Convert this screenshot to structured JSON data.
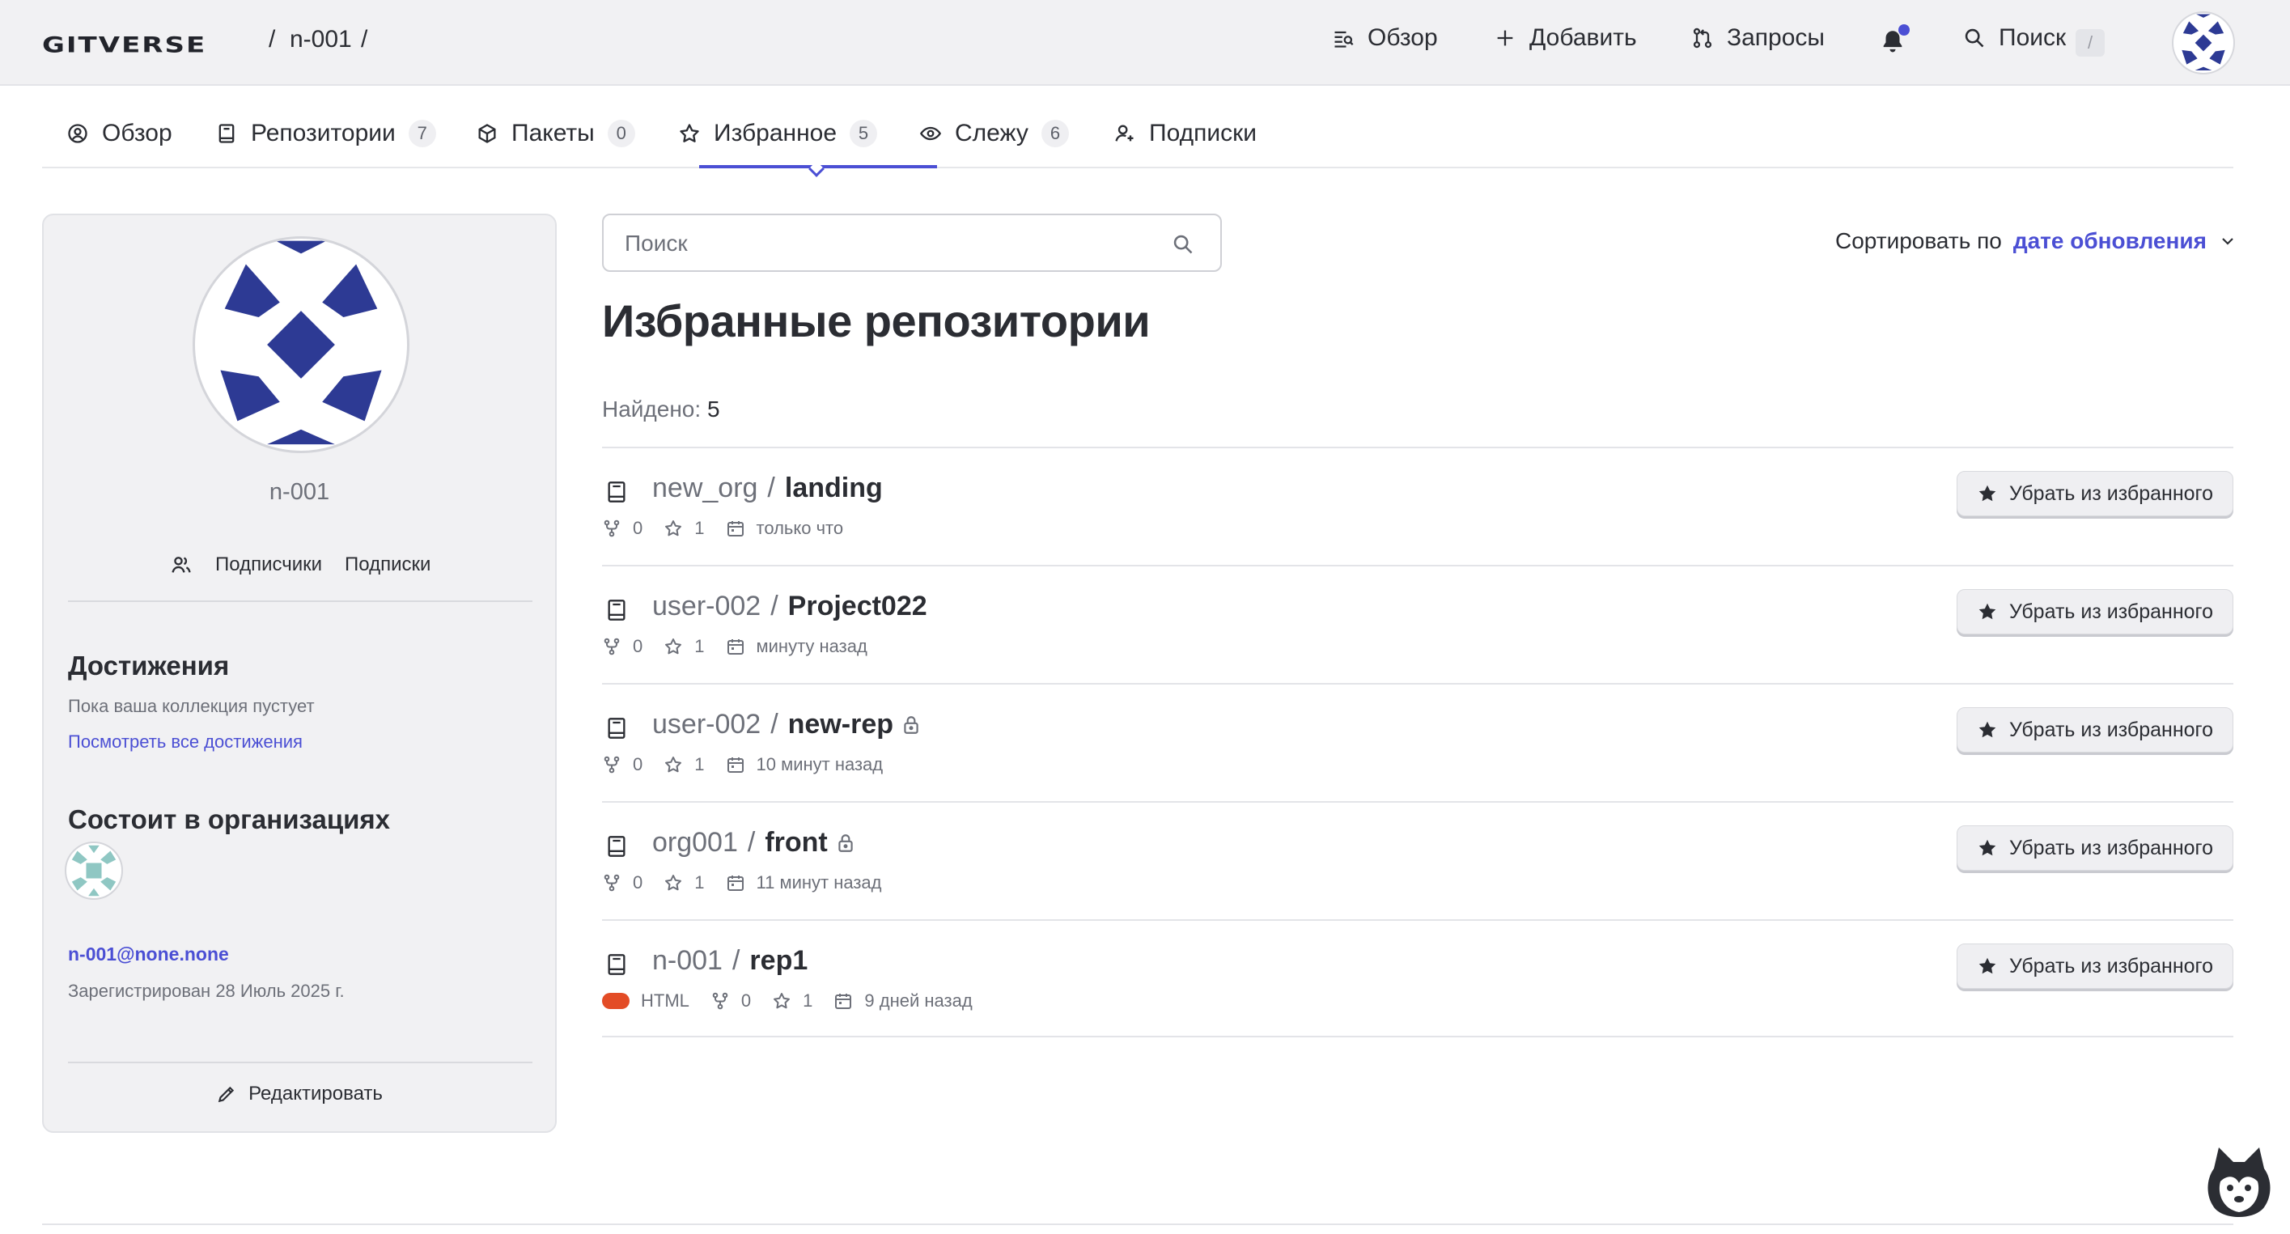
{
  "header": {
    "logo": "GITVERSE",
    "breadcrumb": {
      "sep1": "/",
      "user": "n-001",
      "sep2": "/"
    },
    "nav": {
      "overview": "Обзор",
      "add": "Добавить",
      "requests": "Запросы",
      "search": "Поиск"
    },
    "search_shortcut": "/",
    "icons": [
      "overview-icon",
      "plus-icon",
      "pull-request-icon",
      "bell-icon",
      "search-icon"
    ]
  },
  "tabs": [
    {
      "label": "Обзор",
      "count": null,
      "icon": "profile-icon"
    },
    {
      "label": "Репозитории",
      "count": "7",
      "icon": "repo-icon"
    },
    {
      "label": "Пакеты",
      "count": "0",
      "icon": "package-icon"
    },
    {
      "label": "Избранное",
      "count": "5",
      "icon": "star-icon",
      "active": true
    },
    {
      "label": "Слежу",
      "count": "6",
      "icon": "eye-icon"
    },
    {
      "label": "Подписки",
      "count": null,
      "icon": "person-add-icon"
    }
  ],
  "profile": {
    "username": "n-001",
    "followers": "Подписчики",
    "following": "Подписки",
    "achievements_title": "Достижения",
    "achievements_empty": "Пока ваша коллекция пустует",
    "achievements_link": "Посмотреть все достижения",
    "orgs_title": "Состоит в организациях",
    "email": "n-001@none.none",
    "registered": "Зарегистрирован 28 Июль 2025 г.",
    "edit": "Редактировать"
  },
  "main": {
    "search_placeholder": "Поиск",
    "sort_label": "Сортировать по",
    "sort_value": "дате обновления",
    "title": "Избранные репозитории",
    "found_label": "Найдено:",
    "found_count": "5",
    "unstar_label": "Убрать из избранного",
    "repos": [
      {
        "owner": "new_org",
        "name": "landing",
        "private": false,
        "language": null,
        "forks": "0",
        "stars": "1",
        "updated": "только что"
      },
      {
        "owner": "user-002",
        "name": "Project022",
        "private": false,
        "language": null,
        "forks": "0",
        "stars": "1",
        "updated": "минуту назад"
      },
      {
        "owner": "user-002",
        "name": "new-rep",
        "private": true,
        "language": null,
        "forks": "0",
        "stars": "1",
        "updated": "10 минут назад"
      },
      {
        "owner": "org001",
        "name": "front",
        "private": true,
        "language": null,
        "forks": "0",
        "stars": "1",
        "updated": "11 минут назад"
      },
      {
        "owner": "n-001",
        "name": "rep1",
        "private": false,
        "language": "HTML",
        "forks": "0",
        "stars": "1",
        "updated": "9 дней назад"
      }
    ]
  },
  "colors": {
    "accent": "#4b4fd4",
    "avatar_blue": "#2d3a94",
    "html_lang": "#e34c26",
    "org_avatar": "#8fc7c3"
  }
}
